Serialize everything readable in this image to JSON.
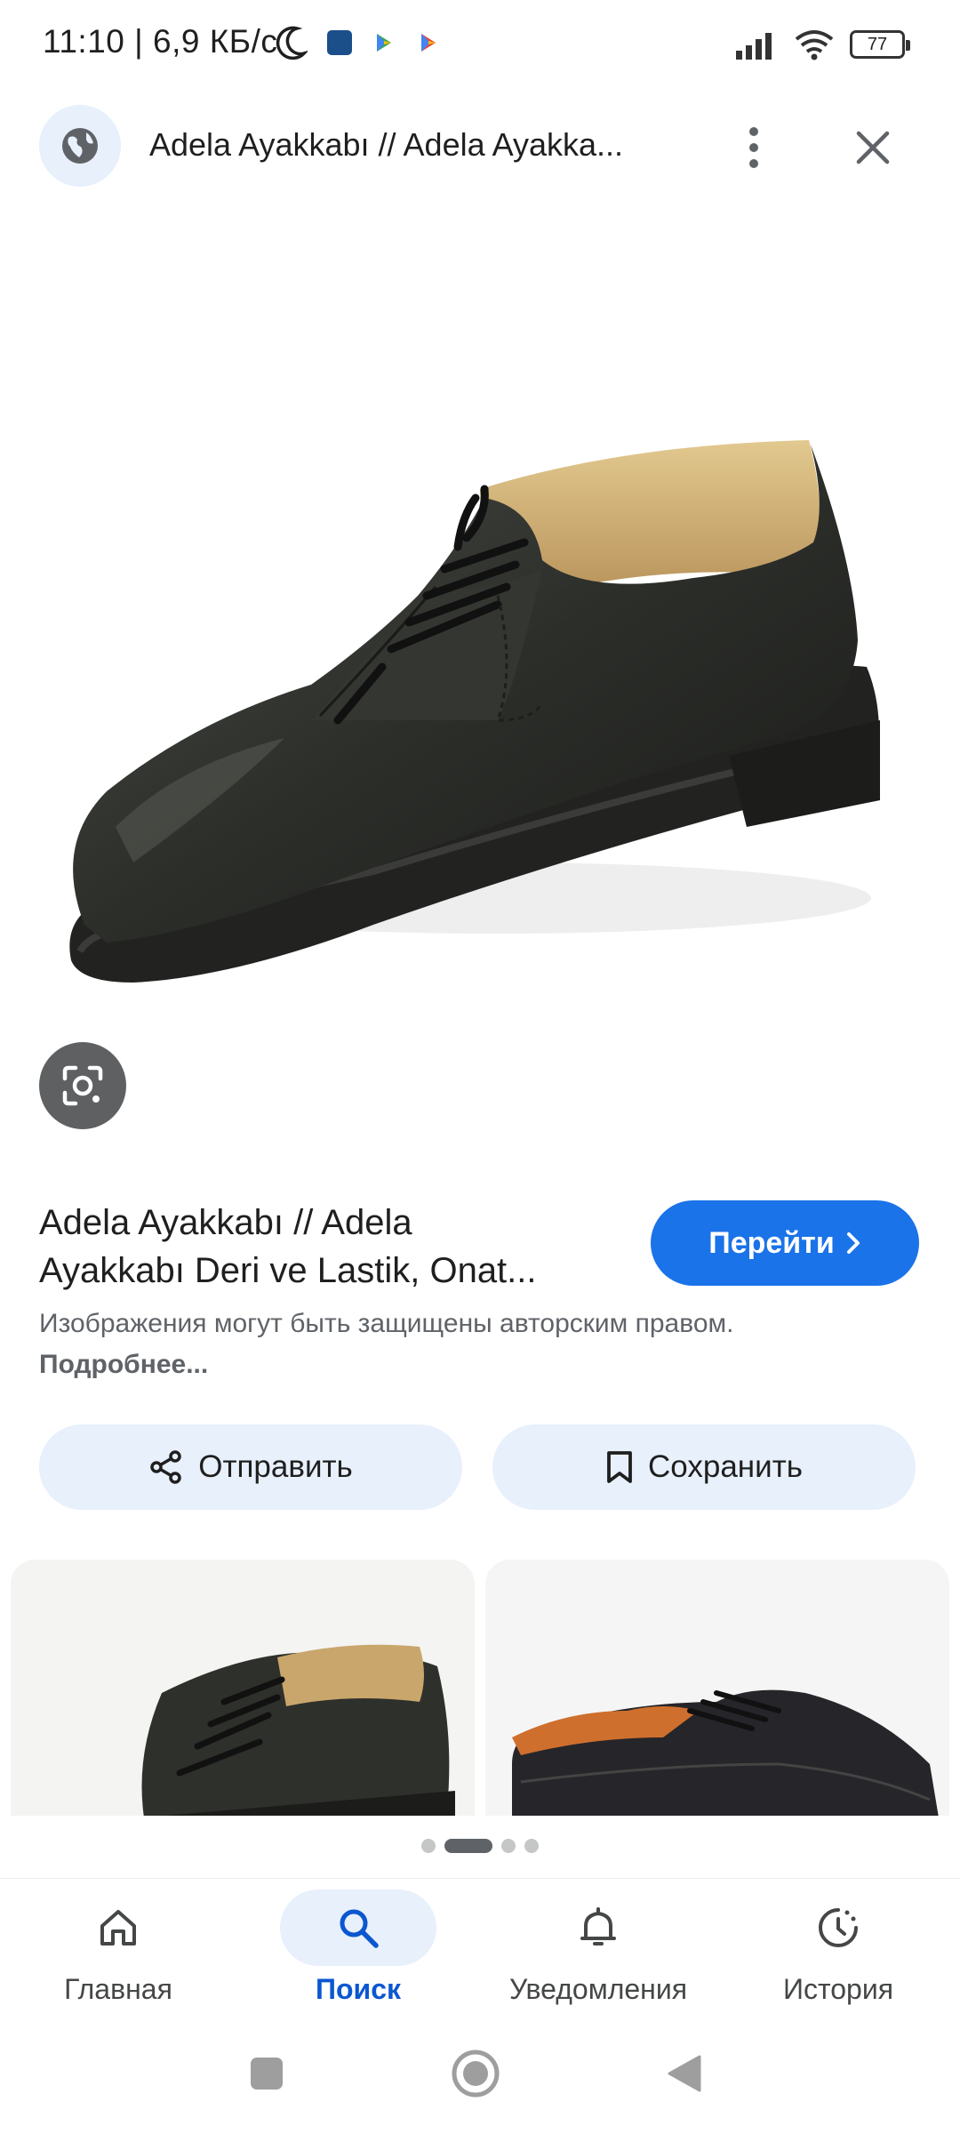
{
  "status_bar": {
    "time": "11:10 | 6,9 КБ/с",
    "battery": "77"
  },
  "top_bar": {
    "title": "Adela Ayakkabı // Adela Ayakka..."
  },
  "result": {
    "title_line1": "Adela Ayakkabı // Adela",
    "title_line2": "Ayakkabı Deri ve Lastik, Onat...",
    "visit_label": "Перейти",
    "copyright_text": "Изображения могут быть защищены авторским правом.",
    "more_link": "Подробнее..."
  },
  "actions": {
    "share_label": "Отправить",
    "save_label": "Сохранить"
  },
  "pager": {
    "total": 4,
    "active_index": 1
  },
  "bottom_nav": {
    "items": [
      {
        "label": "Главная",
        "icon": "home-icon",
        "active": false
      },
      {
        "label": "Поиск",
        "icon": "search-icon",
        "active": true
      },
      {
        "label": "Уведомления",
        "icon": "bell-icon",
        "active": false
      },
      {
        "label": "История",
        "icon": "history-icon",
        "active": false
      }
    ]
  },
  "colors": {
    "accent": "#1a73e8",
    "active_nav": "#0b57d0",
    "chip_bg": "#e8f0fc"
  }
}
